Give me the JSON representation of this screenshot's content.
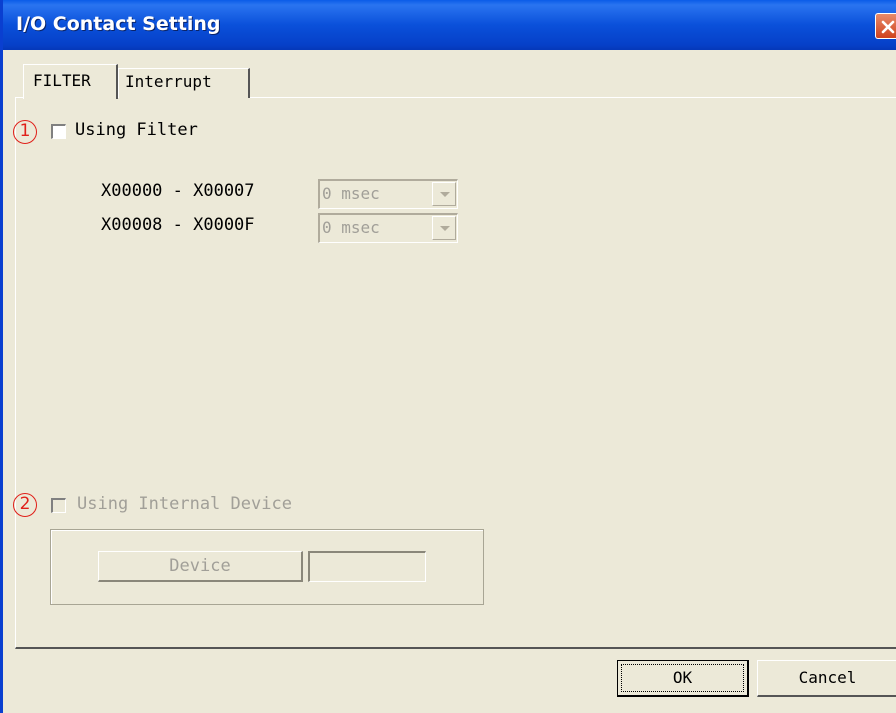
{
  "window": {
    "title": "I/O Contact Setting"
  },
  "tabs": [
    {
      "label": "FILTER",
      "active": true
    },
    {
      "label": "Interrupt",
      "active": false
    }
  ],
  "filter": {
    "marker": "1",
    "using_filter_label": "Using Filter",
    "using_filter_checked": false,
    "ranges": [
      {
        "label": "X00000 - X00007",
        "value": "0 msec"
      },
      {
        "label": "X00008 - X0000F",
        "value": "0 msec"
      }
    ]
  },
  "internal": {
    "marker": "2",
    "using_internal_label": "Using Internal Device",
    "using_internal_checked": false,
    "device_button_label": "Device",
    "device_value": ""
  },
  "buttons": {
    "ok": "OK",
    "cancel": "Cancel"
  },
  "colors": {
    "title_bar": "#0a50da",
    "marker": "#e0201a",
    "face": "#ece9d8"
  }
}
